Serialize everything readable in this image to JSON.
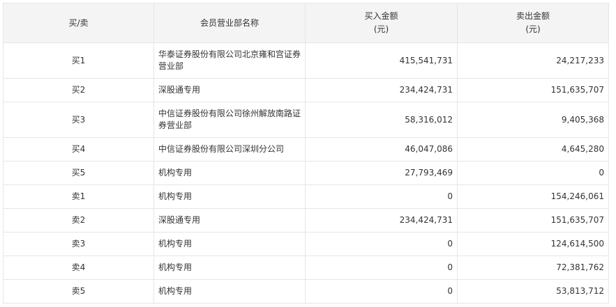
{
  "header": {
    "side": "买/卖",
    "name": "会员营业部名称",
    "buy_line1": "买入金额",
    "buy_line2": "(元)",
    "sell_line1": "卖出金额",
    "sell_line2": "(元)"
  },
  "rows": [
    {
      "side": "买1",
      "name": "华泰证券股份有限公司北京雍和宫证券营业部",
      "buy": "415,541,731",
      "sell": "24,217,233"
    },
    {
      "side": "买2",
      "name": "深股通专用",
      "buy": "234,424,731",
      "sell": "151,635,707"
    },
    {
      "side": "买3",
      "name": "中信证券股份有限公司徐州解放南路证券营业部",
      "buy": "58,316,012",
      "sell": "9,405,368"
    },
    {
      "side": "买4",
      "name": "中信证券股份有限公司深圳分公司",
      "buy": "46,047,086",
      "sell": "4,645,280"
    },
    {
      "side": "买5",
      "name": "机构专用",
      "buy": "27,793,469",
      "sell": "0"
    },
    {
      "side": "卖1",
      "name": "机构专用",
      "buy": "0",
      "sell": "154,246,061"
    },
    {
      "side": "卖2",
      "name": "深股通专用",
      "buy": "234,424,731",
      "sell": "151,635,707"
    },
    {
      "side": "卖3",
      "name": "机构专用",
      "buy": "0",
      "sell": "124,614,500"
    },
    {
      "side": "卖4",
      "name": "机构专用",
      "buy": "0",
      "sell": "72,381,762"
    },
    {
      "side": "卖5",
      "name": "机构专用",
      "buy": "0",
      "sell": "53,813,712"
    }
  ]
}
